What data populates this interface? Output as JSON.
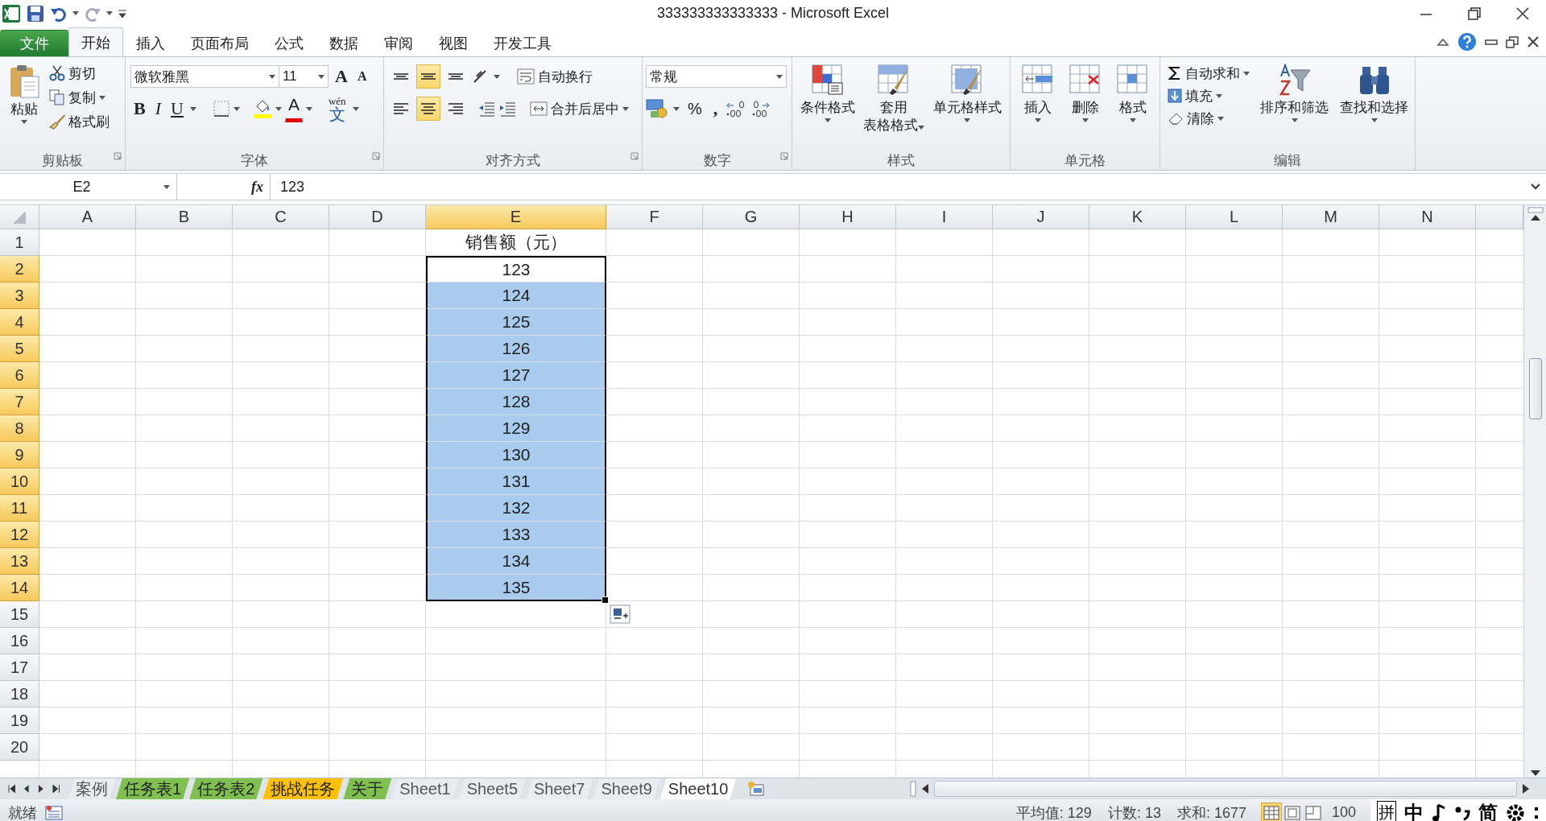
{
  "window": {
    "title": "333333333333333 - Microsoft Excel"
  },
  "menu_tabs": [
    {
      "label": "文件",
      "kind": "file",
      "selected": false
    },
    {
      "label": "开始",
      "kind": "tab",
      "selected": true
    },
    {
      "label": "插入",
      "kind": "tab",
      "selected": false
    },
    {
      "label": "页面布局",
      "kind": "tab",
      "selected": false
    },
    {
      "label": "公式",
      "kind": "tab",
      "selected": false
    },
    {
      "label": "数据",
      "kind": "tab",
      "selected": false
    },
    {
      "label": "审阅",
      "kind": "tab",
      "selected": false
    },
    {
      "label": "视图",
      "kind": "tab",
      "selected": false
    },
    {
      "label": "开发工具",
      "kind": "tab",
      "selected": false
    }
  ],
  "clipboard": {
    "label": "剪贴板",
    "paste": "粘贴",
    "commands": [
      "剪切",
      "复制",
      "格式刷"
    ]
  },
  "font": {
    "label": "字体",
    "font_name": "微软雅黑",
    "font_size": "11",
    "grow": "A",
    "shrink": "A",
    "bold": "B",
    "italic": "I",
    "underline": "U",
    "font_color": "A",
    "phonetic_top": "wén",
    "phonetic_bottom": "文"
  },
  "alignment": {
    "label": "对齐方式",
    "wrap": "自动换行",
    "merge": "合并后居中",
    "buttons": [
      {
        "kind": "top",
        "selected": false
      },
      {
        "kind": "middle",
        "selected": true
      },
      {
        "kind": "bottom",
        "selected": false
      },
      {
        "kind": "left",
        "selected": false
      },
      {
        "kind": "center",
        "selected": true
      },
      {
        "kind": "right",
        "selected": false
      }
    ]
  },
  "number": {
    "label": "数字",
    "format": "常规",
    "percent": "%",
    "comma": ","
  },
  "styles": {
    "label": "样式",
    "buttons": [
      {
        "lines": [
          "条件格式"
        ]
      },
      {
        "lines": [
          "套用",
          "表格格式"
        ]
      },
      {
        "lines": [
          "单元格样式"
        ]
      }
    ]
  },
  "cells": {
    "label": "单元格",
    "buttons": [
      "插入",
      "删除",
      "格式"
    ]
  },
  "editing": {
    "label": "编辑",
    "commands": [
      "自动求和",
      "填充",
      "清除"
    ],
    "buttons": [
      "排序和筛选",
      "查找和选择"
    ]
  },
  "formula_bar": {
    "name_box": "E2",
    "function_label": "fx",
    "value": "123"
  },
  "sheet": {
    "columns": [
      {
        "label": "A",
        "selected": false
      },
      {
        "label": "B",
        "selected": false
      },
      {
        "label": "C",
        "selected": false
      },
      {
        "label": "D",
        "selected": false
      },
      {
        "label": "E",
        "selected": true
      },
      {
        "label": "F",
        "selected": false
      },
      {
        "label": "G",
        "selected": false
      },
      {
        "label": "H",
        "selected": false
      },
      {
        "label": "I",
        "selected": false
      },
      {
        "label": "J",
        "selected": false
      },
      {
        "label": "K",
        "selected": false
      },
      {
        "label": "L",
        "selected": false
      },
      {
        "label": "M",
        "selected": false
      },
      {
        "label": "N",
        "selected": false
      }
    ],
    "rows": [
      {
        "label": "1",
        "selected": false,
        "e_cell": {
          "value": "销售额（元）",
          "in_selection": false,
          "active": false
        }
      },
      {
        "label": "2",
        "selected": true,
        "e_cell": {
          "value": "123",
          "in_selection": true,
          "active": true
        }
      },
      {
        "label": "3",
        "selected": true,
        "e_cell": {
          "value": "124",
          "in_selection": true,
          "active": false
        }
      },
      {
        "label": "4",
        "selected": true,
        "e_cell": {
          "value": "125",
          "in_selection": true,
          "active": false
        }
      },
      {
        "label": "5",
        "selected": true,
        "e_cell": {
          "value": "126",
          "in_selection": true,
          "active": false
        }
      },
      {
        "label": "6",
        "selected": true,
        "e_cell": {
          "value": "127",
          "in_selection": true,
          "active": false
        }
      },
      {
        "label": "7",
        "selected": true,
        "e_cell": {
          "value": "128",
          "in_selection": true,
          "active": false
        }
      },
      {
        "label": "8",
        "selected": true,
        "e_cell": {
          "value": "129",
          "in_selection": true,
          "active": false
        }
      },
      {
        "label": "9",
        "selected": true,
        "e_cell": {
          "value": "130",
          "in_selection": true,
          "active": false
        }
      },
      {
        "label": "10",
        "selected": true,
        "e_cell": {
          "value": "131",
          "in_selection": true,
          "active": false
        }
      },
      {
        "label": "11",
        "selected": true,
        "e_cell": {
          "value": "132",
          "in_selection": true,
          "active": false
        }
      },
      {
        "label": "12",
        "selected": true,
        "e_cell": {
          "value": "133",
          "in_selection": true,
          "active": false
        }
      },
      {
        "label": "13",
        "selected": true,
        "e_cell": {
          "value": "134",
          "in_selection": true,
          "active": false
        }
      },
      {
        "label": "14",
        "selected": true,
        "e_cell": {
          "value": "135",
          "in_selection": true,
          "active": false
        }
      },
      {
        "label": "15",
        "selected": false
      },
      {
        "label": "16",
        "selected": false
      },
      {
        "label": "17",
        "selected": false
      },
      {
        "label": "18",
        "selected": false
      },
      {
        "label": "19",
        "selected": false
      },
      {
        "label": "20",
        "selected": false
      }
    ]
  },
  "sheet_tabs": [
    {
      "label": "案例",
      "selected": false
    },
    {
      "label": "任务表1",
      "selected": false,
      "color": "#7fbf4f"
    },
    {
      "label": "任务表2",
      "selected": false,
      "color": "#7fbf4f"
    },
    {
      "label": "挑战任务",
      "selected": false,
      "color": "#ffc000"
    },
    {
      "label": "关于",
      "selected": false,
      "color": "#7fbf4f"
    },
    {
      "label": "Sheet1",
      "selected": false
    },
    {
      "label": "Sheet5",
      "selected": false
    },
    {
      "label": "Sheet7",
      "selected": false
    },
    {
      "label": "Sheet9",
      "selected": false
    },
    {
      "label": "Sheet10",
      "selected": true
    }
  ],
  "status_bar": {
    "ready": "就绪",
    "average": "平均值: 129",
    "count": "计数: 13",
    "sum": "求和: 1677",
    "zoom": "100",
    "views": [
      {
        "kind": "normal",
        "selected": true
      },
      {
        "kind": "layout",
        "selected": false
      },
      {
        "kind": "break",
        "selected": false
      }
    ]
  },
  "ime_bar": {
    "mode": "拼",
    "language": "中",
    "script": "简"
  }
}
